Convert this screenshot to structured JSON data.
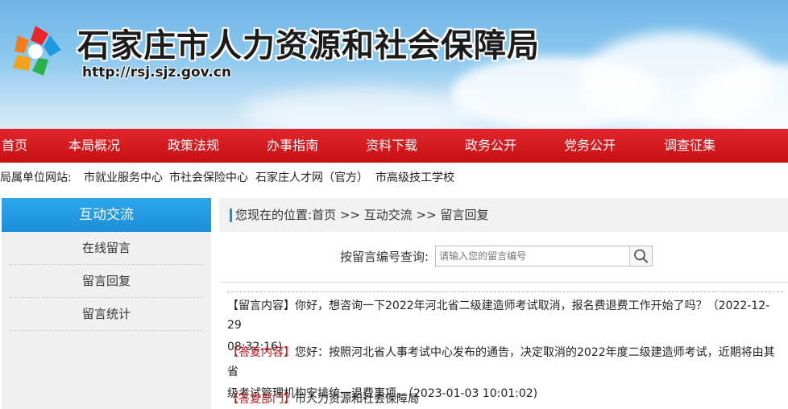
{
  "header": {
    "title": "石家庄市人力资源和社会保障局",
    "url": "http://rsj.sjz.gov.cn"
  },
  "nav": {
    "items": [
      "首页",
      "本局概况",
      "政策法规",
      "办事指南",
      "资料下载",
      "政务公开",
      "党务公开",
      "调查征集"
    ]
  },
  "sublinks": {
    "label": "局属单位网站:",
    "items": [
      "市就业服务中心",
      "市社会保险中心",
      "石家庄人才网（官方）",
      "市高级技工学校"
    ]
  },
  "sidebar": {
    "title": "互动交流",
    "items": [
      "在线留言",
      "留言回复",
      "留言统计"
    ]
  },
  "breadcrumb": {
    "prefix": "您现在的位置:",
    "home": "首页",
    "sep1": " >> ",
    "level1": "互动交流",
    "sep2": " >> ",
    "level2": "留言回复"
  },
  "search": {
    "label": "按留言编号查询:",
    "placeholder": "请输入您的留言编号",
    "icon": "search-icon"
  },
  "message": {
    "content_tag": "【留言内容】",
    "content_line1": "你好，想咨询一下2022年河北省二级建造师考试取消，报名费退费工作开始了吗？（2022-12-29",
    "content_line2": "08:32:16)",
    "reply_tag": "【答复内容】",
    "reply_line1": "您好：按照河北省人事考试中心发布的通告，决定取消的2022年度二级建造师考试，近期将由其省",
    "reply_line2": "级考试管理机构安排统一退费事项。（2023-01-03 10:01:02)",
    "dept_tag": "【答复部门】",
    "dept": "市人力资源和社会保障局"
  },
  "colors": {
    "nav_red": "#d41a1e",
    "accent_blue": "#1b8fd8",
    "reply_red": "#c0171b"
  }
}
